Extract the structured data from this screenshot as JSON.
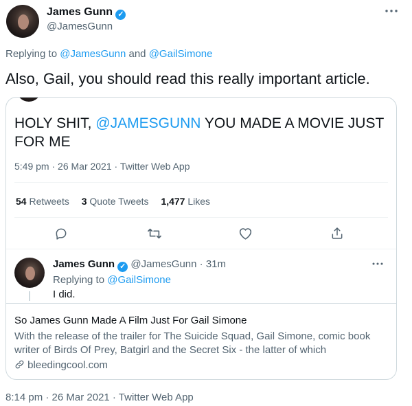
{
  "main_tweet": {
    "author_name": "James Gunn",
    "handle": "@JamesGunn",
    "replying_prefix": "Replying to",
    "replying_to_1": "@JamesGunn",
    "replying_and": "and",
    "replying_to_2": "@GailSimone",
    "text": "Also, Gail, you should read this really important article.",
    "timestamp": "8:14 pm · 26 Mar 2021 · Twitter Web App"
  },
  "quoted_tweet": {
    "text_before": "HOLY SHIT,",
    "mention": "@JAMESGUNN",
    "text_after": "YOU MADE A MOVIE JUST FOR ME",
    "timestamp": "5:49 pm · 26 Mar 2021 · Twitter Web App",
    "stats": {
      "retweets_count": "54",
      "retweets_label": "Retweets",
      "quotes_count": "3",
      "quotes_label": "Quote Tweets",
      "likes_count": "1,477",
      "likes_label": "Likes"
    }
  },
  "reply_tweet": {
    "author_name": "James Gunn",
    "handle": "@JamesGunn",
    "time": "31m",
    "replying_prefix": "Replying to",
    "replying_to": "@GailSimone",
    "text": "I did."
  },
  "link_card": {
    "title": "So James Gunn Made A Film Just For Gail Simone",
    "description": "With the release of the trailer for The Suicide Squad, Gail Simone, comic book writer of Birds Of Prey, Batgirl and the Secret Six - the latter of which",
    "domain": "bleedingcool.com"
  },
  "icons": {
    "more": "more-icon",
    "verified": "verified-badge-icon",
    "reply": "reply-icon",
    "retweet": "retweet-icon",
    "like": "like-icon",
    "share": "share-icon",
    "link": "link-icon"
  },
  "colors": {
    "accent": "#1d9bf0",
    "text": "#0f1419",
    "muted": "#536471",
    "border": "#cfd9de"
  }
}
